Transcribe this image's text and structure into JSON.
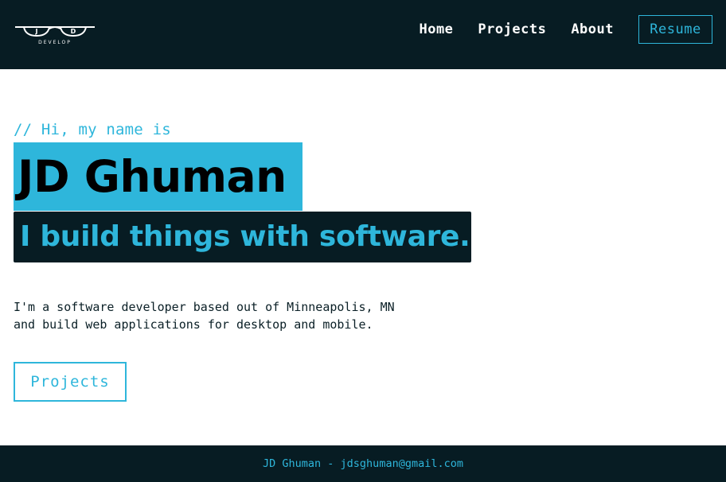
{
  "colors": {
    "dark": "#071c23",
    "accent": "#2eb6db",
    "background": "#ffffff"
  },
  "header": {
    "logo": {
      "left_letter": "J",
      "right_letter": "D",
      "subtext": "DEVELOP",
      "icon": "glasses-icon"
    },
    "nav": {
      "items": [
        {
          "label": "Home"
        },
        {
          "label": "Projects"
        },
        {
          "label": "About"
        }
      ],
      "resume_label": "Resume"
    }
  },
  "hero": {
    "intro": "// Hi, my name is",
    "name": "JD Ghuman",
    "tagline": "I build things with software.",
    "description": [
      "I'm a software developer based out of Minneapolis, MN",
      "and build web applications for desktop and mobile."
    ],
    "cta_label": "Projects"
  },
  "footer": {
    "text": "JD Ghuman - jdsghuman@gmail.com"
  }
}
